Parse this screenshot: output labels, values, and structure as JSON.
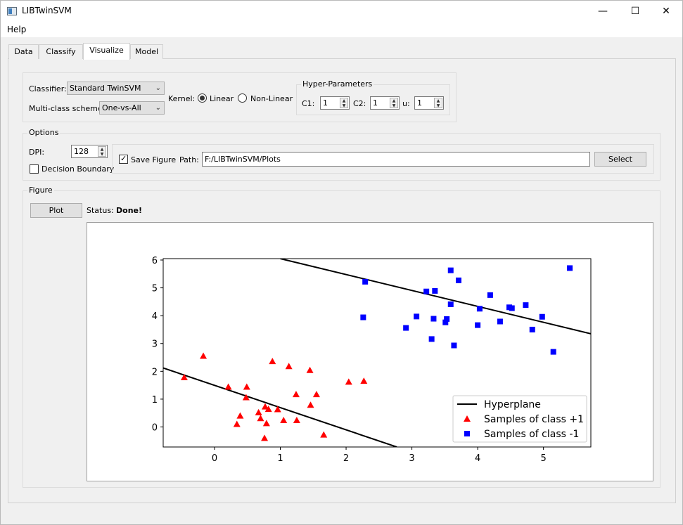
{
  "window": {
    "title": "LIBTwinSVM",
    "minimize_glyph": "—",
    "maximize_glyph": "☐",
    "close_glyph": "✕"
  },
  "menu": {
    "help": "Help"
  },
  "tabs": [
    {
      "label": "Data",
      "active": false
    },
    {
      "label": "Classify",
      "active": false
    },
    {
      "label": "Visualize",
      "active": true
    },
    {
      "label": "Model",
      "active": false
    }
  ],
  "classifier_group": {
    "classifier_label": "Classifier:",
    "classifier_value": "Standard TwinSVM",
    "multiclass_label": "Multi-class scheme:",
    "multiclass_value": "One-vs-All",
    "kernel_label": "Kernel:",
    "kernel_options": [
      "Linear",
      "Non-Linear"
    ],
    "kernel_selected": "Linear"
  },
  "hyper_parameters": {
    "title": "Hyper-Parameters",
    "c1_label": "C1:",
    "c1_value": "1",
    "c2_label": "C2:",
    "c2_value": "1",
    "u_label": "u:",
    "u_value": "1"
  },
  "options": {
    "title": "Options",
    "dpi_label": "DPI:",
    "dpi_value": "128",
    "decision_boundary_label": "Decision Boundary",
    "decision_boundary_checked": false,
    "save_figure_label": "Save Figure",
    "save_figure_checked": true,
    "path_label": "Path:",
    "path_value": "F:/LIBTwinSVM/Plots",
    "select_button": "Select"
  },
  "figure": {
    "title": "Figure",
    "plot_button": "Plot",
    "status_label": "Status:",
    "status_value": "Done!"
  },
  "colors": {
    "class_pos": "#ff0000",
    "class_neg": "#0000ff",
    "hyperplane": "#000000"
  },
  "chart_data": {
    "type": "scatter",
    "xlim": [
      -0.78,
      5.72
    ],
    "ylim": [
      -0.72,
      6.05
    ],
    "x_ticks": [
      0,
      1,
      2,
      3,
      4,
      5
    ],
    "y_ticks": [
      0,
      1,
      2,
      3,
      4,
      5,
      6
    ],
    "legend_position": "lower-right",
    "legend": [
      {
        "name": "Hyperplane",
        "kind": "line"
      },
      {
        "name": "Samples of class +1",
        "kind": "triangle"
      },
      {
        "name": "Samples of class -1",
        "kind": "square"
      }
    ],
    "hyperplanes": [
      {
        "x": [
          -0.78,
          2.77
        ],
        "y": [
          2.12,
          -0.72
        ]
      },
      {
        "x": [
          1.0,
          5.72
        ],
        "y": [
          6.05,
          3.35
        ]
      }
    ],
    "series": [
      {
        "name": "Samples of class +1",
        "marker": "triangle",
        "points": [
          [
            -0.46,
            1.78
          ],
          [
            -0.17,
            2.55
          ],
          [
            0.21,
            1.44
          ],
          [
            0.48,
            1.06
          ],
          [
            0.49,
            1.44
          ],
          [
            0.34,
            0.1
          ],
          [
            0.39,
            0.4
          ],
          [
            0.67,
            0.52
          ],
          [
            0.7,
            0.31
          ],
          [
            0.77,
            0.73
          ],
          [
            0.79,
            0.13
          ],
          [
            0.82,
            0.64
          ],
          [
            0.88,
            2.36
          ],
          [
            0.96,
            0.63
          ],
          [
            1.05,
            0.24
          ],
          [
            1.13,
            2.18
          ],
          [
            1.24,
            1.17
          ],
          [
            1.25,
            0.24
          ],
          [
            1.45,
            2.04
          ],
          [
            1.46,
            0.79
          ],
          [
            1.55,
            1.17
          ],
          [
            1.66,
            -0.28
          ],
          [
            2.04,
            1.62
          ],
          [
            2.27,
            1.65
          ],
          [
            0.76,
            -0.4
          ]
        ]
      },
      {
        "name": "Samples of class -1",
        "marker": "square",
        "points": [
          [
            2.26,
            3.94
          ],
          [
            2.29,
            5.22
          ],
          [
            2.91,
            3.56
          ],
          [
            3.07,
            3.97
          ],
          [
            3.22,
            4.87
          ],
          [
            3.3,
            3.16
          ],
          [
            3.33,
            3.89
          ],
          [
            3.35,
            4.89
          ],
          [
            3.51,
            3.76
          ],
          [
            3.53,
            3.88
          ],
          [
            3.59,
            5.63
          ],
          [
            3.59,
            4.41
          ],
          [
            3.64,
            2.93
          ],
          [
            3.71,
            5.27
          ],
          [
            4.0,
            3.66
          ],
          [
            4.03,
            4.25
          ],
          [
            4.19,
            4.74
          ],
          [
            4.34,
            3.79
          ],
          [
            4.48,
            4.3
          ],
          [
            4.52,
            4.27
          ],
          [
            4.73,
            4.38
          ],
          [
            4.83,
            3.5
          ],
          [
            4.98,
            3.96
          ],
          [
            5.15,
            2.7
          ],
          [
            5.4,
            5.71
          ]
        ]
      }
    ]
  }
}
